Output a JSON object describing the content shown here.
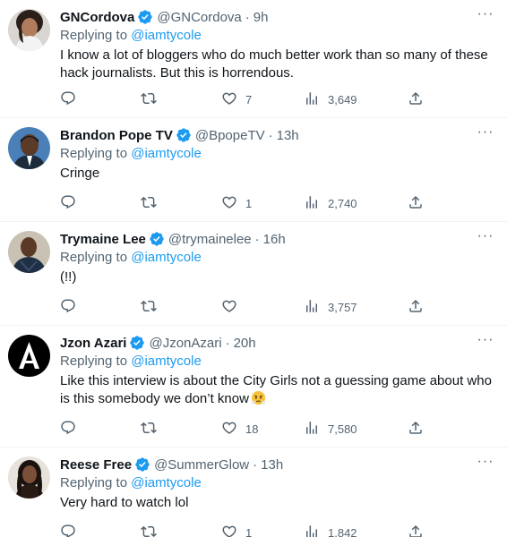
{
  "replies": [
    {
      "name": "GNCordova",
      "handle": "@GNCordova",
      "time": "9h",
      "replying_label": "Replying to",
      "replying_to": "@iamtycole",
      "text": "I know a lot of bloggers who do much better work than so many of these hack journalists. But this is horrendous.",
      "emoji": "",
      "replies_count": "",
      "retweets_count": "",
      "likes_count": "7",
      "views_count": "3,649"
    },
    {
      "name": "Brandon Pope TV",
      "handle": "@BpopeTV",
      "time": "13h",
      "replying_label": "Replying to",
      "replying_to": "@iamtycole",
      "text": "Cringe",
      "emoji": "",
      "replies_count": "",
      "retweets_count": "",
      "likes_count": "1",
      "views_count": "2,740"
    },
    {
      "name": "Trymaine Lee",
      "handle": "@trymainelee",
      "time": "16h",
      "replying_label": "Replying to",
      "replying_to": "@iamtycole",
      "text": "(!!)",
      "emoji": "",
      "replies_count": "",
      "retweets_count": "",
      "likes_count": "",
      "views_count": "3,757"
    },
    {
      "name": "Jzon Azari",
      "handle": "@JzonAzari",
      "time": "20h",
      "replying_label": "Replying to",
      "replying_to": "@iamtycole",
      "text": "Like this interview is about the City Girls not a guessing game about who is this somebody we don’t know",
      "emoji": "face-with-steam-from-nose",
      "replies_count": "",
      "retweets_count": "",
      "likes_count": "18",
      "views_count": "7,580"
    },
    {
      "name": "Reese Free",
      "handle": "@SummerGlow",
      "time": "13h",
      "replying_label": "Replying to",
      "replying_to": "@iamtycole",
      "text": "Very hard to watch lol",
      "emoji": "",
      "replies_count": "",
      "retweets_count": "",
      "likes_count": "1",
      "views_count": "1,842"
    }
  ],
  "ui": {
    "more_glyph": "···",
    "time_separator": "·"
  },
  "colors": {
    "verified": "#1d9bf0",
    "mention": "#1d9bf0",
    "secondary_text": "#536471",
    "primary_text": "#0f1419",
    "divider": "#eff3f4"
  },
  "icons": [
    "reply-icon",
    "retweet-icon",
    "like-icon",
    "views-icon",
    "share-icon",
    "more-icon",
    "verified-badge-icon"
  ]
}
